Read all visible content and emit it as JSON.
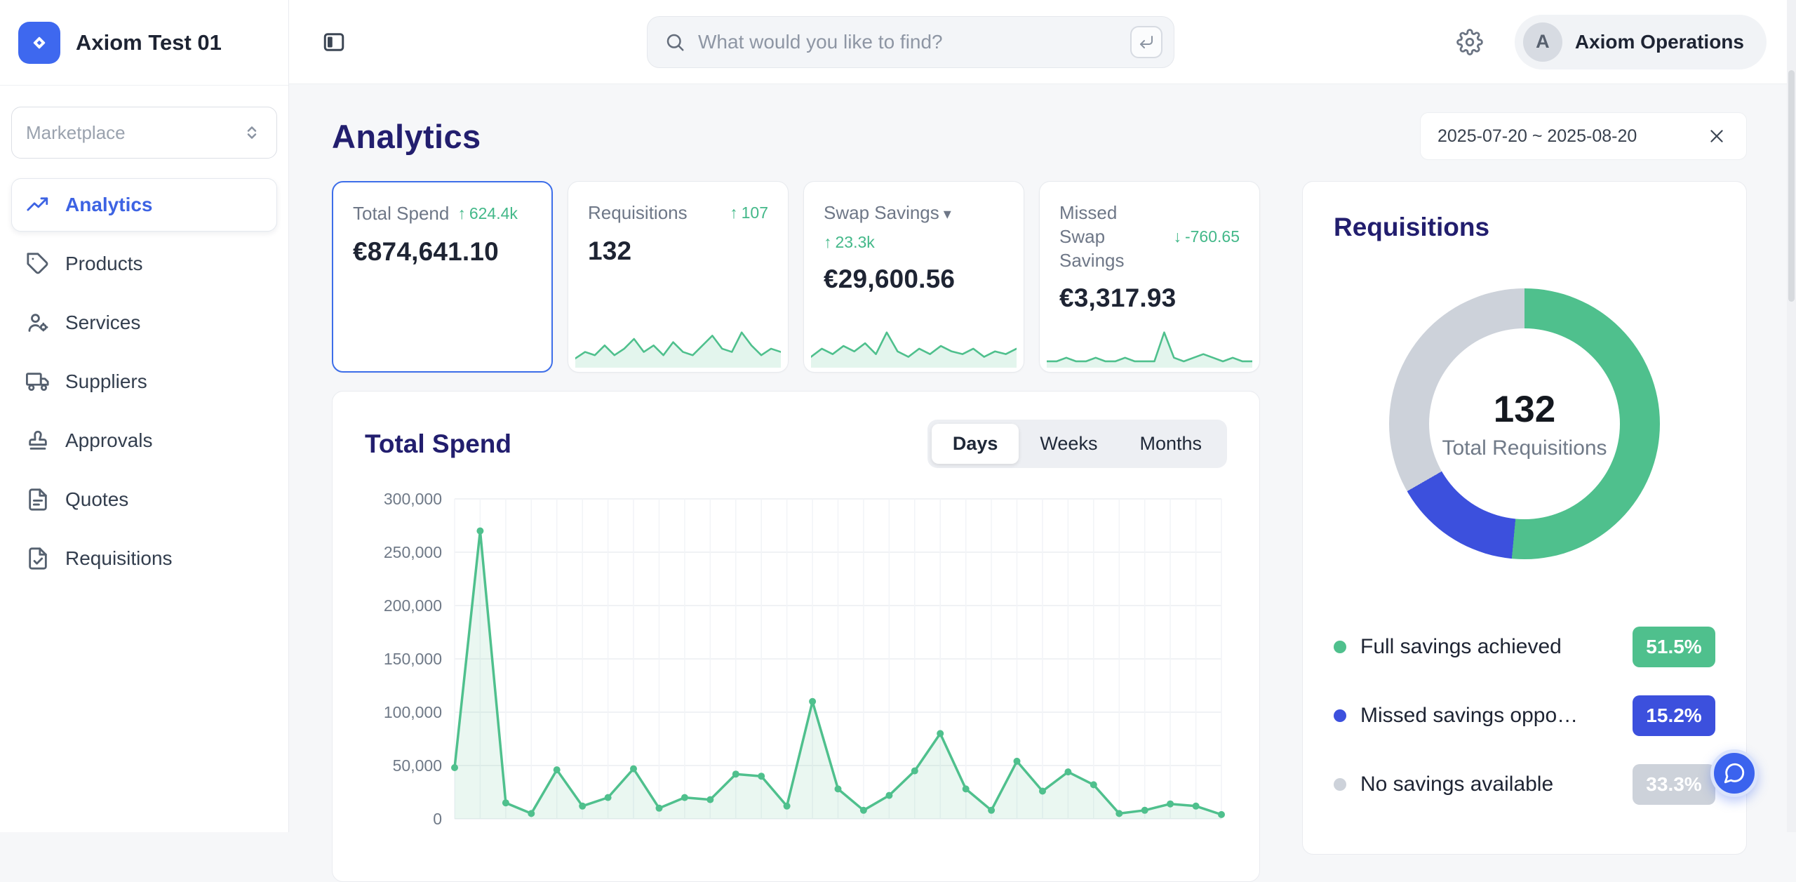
{
  "app": {
    "title": "Axiom Test 01"
  },
  "topbar": {
    "search_placeholder": "What would you like to find?",
    "user_initial": "A",
    "user_name": "Axiom Operations"
  },
  "sidebar": {
    "select_value": "Marketplace",
    "items": [
      {
        "label": "Analytics"
      },
      {
        "label": "Products"
      },
      {
        "label": "Services"
      },
      {
        "label": "Suppliers"
      },
      {
        "label": "Approvals"
      },
      {
        "label": "Quotes"
      },
      {
        "label": "Requisitions"
      }
    ]
  },
  "page": {
    "title": "Analytics",
    "date_range": "2025-07-20 ~ 2025-08-20"
  },
  "kpis": [
    {
      "label": "Total Spend",
      "arrow": "↑",
      "delta": "624.4k",
      "value": "€874,641.10",
      "spark": []
    },
    {
      "label": "Requisitions",
      "arrow": "↑",
      "delta": "107",
      "value": "132",
      "spark": [
        2,
        4,
        3,
        6,
        3,
        5,
        8,
        4,
        6,
        3,
        7,
        4,
        3,
        6,
        9,
        5,
        4,
        10,
        6,
        3,
        5,
        4
      ]
    },
    {
      "label": "Swap Savings",
      "arrow": "↑",
      "delta": "23.3k",
      "value": "€29,600.56",
      "spark": [
        3,
        6,
        4,
        7,
        5,
        8,
        4,
        12,
        5,
        3,
        6,
        4,
        7,
        5,
        4,
        6,
        3,
        5,
        4,
        6
      ]
    },
    {
      "label": "Missed Swap Savings",
      "arrow": "↓",
      "delta": "-760.65",
      "value": "€3,317.93",
      "spark": [
        1,
        1,
        2,
        1,
        1,
        2,
        1,
        1,
        2,
        1,
        1,
        1,
        9,
        2,
        1,
        2,
        3,
        2,
        1,
        2,
        1,
        1
      ]
    }
  ],
  "chart_data": [
    {
      "type": "area",
      "title": "Total Spend",
      "toggle": [
        "Days",
        "Weeks",
        "Months"
      ],
      "active_toggle": "Days",
      "xlabel": "",
      "ylabel": "",
      "ylim": [
        0,
        300000
      ],
      "yticks": [
        "300,000",
        "250,000",
        "200,000",
        "150,000",
        "100,000",
        "50,000",
        "0"
      ],
      "values": [
        48000,
        270000,
        15000,
        5000,
        46000,
        12000,
        20000,
        47000,
        10000,
        20000,
        18000,
        42000,
        40000,
        12000,
        110000,
        28000,
        8000,
        22000,
        45000,
        80000,
        28000,
        8000,
        54000,
        26000,
        44000,
        32000,
        5000,
        8000,
        14000,
        12000,
        4000
      ],
      "line_color": "#4fc08d",
      "grid": true,
      "legend_position": "none"
    },
    {
      "type": "pie",
      "subtype": "donut",
      "title": "Requisitions",
      "center_value": "132",
      "center_label": "Total Requisitions",
      "slices": [
        {
          "label": "Full savings achieved",
          "pct": 51.5,
          "display": "51.5%",
          "color": "#4fc08d"
        },
        {
          "label": "Missed savings oppo…",
          "pct": 15.2,
          "display": "15.2%",
          "color": "#3c50dd"
        },
        {
          "label": "No savings available",
          "pct": 33.3,
          "display": "33.3%",
          "color": "#cdd2da"
        }
      ]
    }
  ]
}
